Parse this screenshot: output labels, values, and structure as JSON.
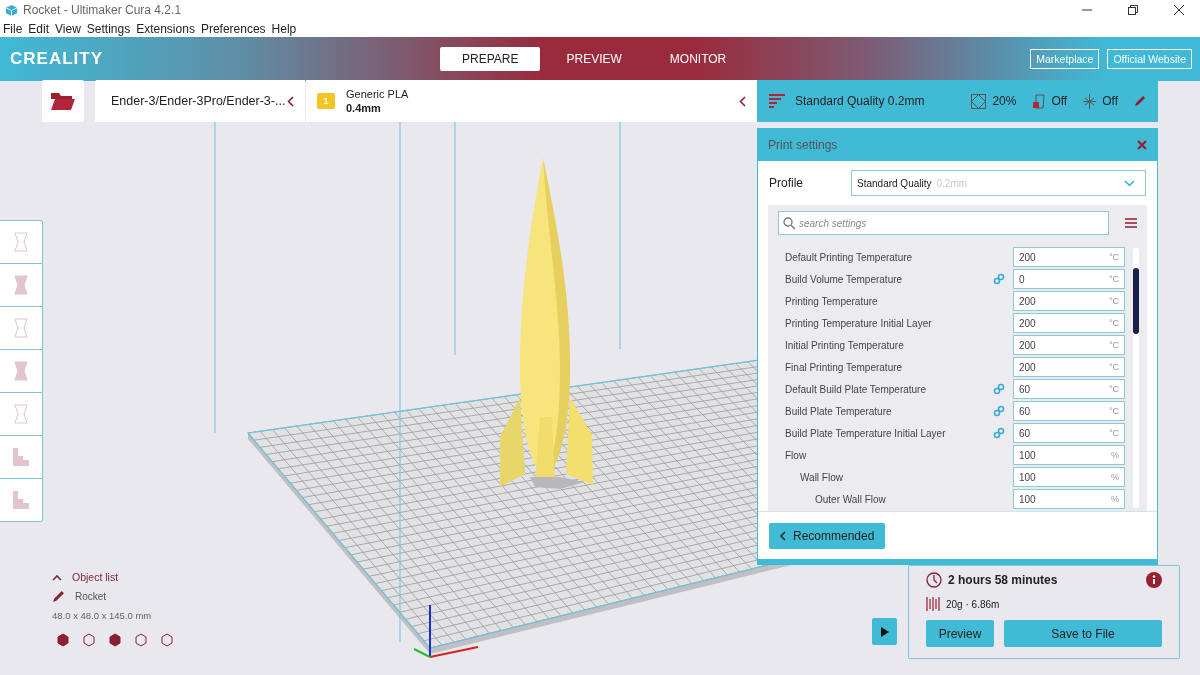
{
  "window": {
    "title": "Rocket - Ultimaker Cura 4.2.1"
  },
  "menu": [
    "File",
    "Edit",
    "View",
    "Settings",
    "Extensions",
    "Preferences",
    "Help"
  ],
  "header": {
    "logo": "CREALITY",
    "tabs": [
      {
        "label": "PREPARE",
        "selected": true
      },
      {
        "label": "PREVIEW",
        "selected": false
      },
      {
        "label": "MONITOR",
        "selected": false
      }
    ],
    "links": [
      "Marketplace",
      "Official Website"
    ]
  },
  "printer": {
    "name": "Ender-3/Ender-3Pro/Ender-3-...",
    "extruder_badge": "1",
    "material": "Generic PLA",
    "nozzle": "0.4mm"
  },
  "quality_bar": {
    "profile": "Standard Quality 0.2mm",
    "infill": "20%",
    "support": "Off",
    "adhesion": "Off"
  },
  "print_settings": {
    "title": "Print settings",
    "profile_label": "Profile",
    "profile_value": "Standard Quality",
    "profile_suffix": "0.2mm",
    "search_placeholder": "search settings",
    "settings": [
      {
        "label": "Default Printing Temperature",
        "linked": false,
        "value": "200",
        "unit": "°C"
      },
      {
        "label": "Build Volume Temperature",
        "linked": true,
        "value": "0",
        "unit": "°C"
      },
      {
        "label": "Printing Temperature",
        "linked": false,
        "value": "200",
        "unit": "°C"
      },
      {
        "label": "Printing Temperature Initial Layer",
        "linked": false,
        "value": "200",
        "unit": "°C"
      },
      {
        "label": "Initial Printing Temperature",
        "linked": false,
        "value": "200",
        "unit": "°C"
      },
      {
        "label": "Final Printing Temperature",
        "linked": false,
        "value": "200",
        "unit": "°C"
      },
      {
        "label": "Default Build Plate Temperature",
        "linked": true,
        "value": "60",
        "unit": "°C"
      },
      {
        "label": "Build Plate Temperature",
        "linked": true,
        "value": "60",
        "unit": "°C"
      },
      {
        "label": "Build Plate Temperature Initial Layer",
        "linked": true,
        "value": "60",
        "unit": "°C"
      },
      {
        "label": "Flow",
        "linked": false,
        "value": "100",
        "unit": "%",
        "children": [
          {
            "label": "Wall Flow",
            "linked": false,
            "value": "100",
            "unit": "%",
            "children": [
              {
                "label": "Outer Wall Flow",
                "linked": false,
                "value": "100",
                "unit": "%"
              }
            ]
          }
        ]
      }
    ],
    "mode_button": "Recommended"
  },
  "object_list": {
    "title": "Object list",
    "object": "Rocket",
    "dimensions": "48.0 x 48.0 x 145.0 mm"
  },
  "estimate": {
    "time": "2 hours 58 minutes",
    "material": "20g · 6.86m",
    "buttons": [
      "Preview",
      "Save to File"
    ]
  }
}
